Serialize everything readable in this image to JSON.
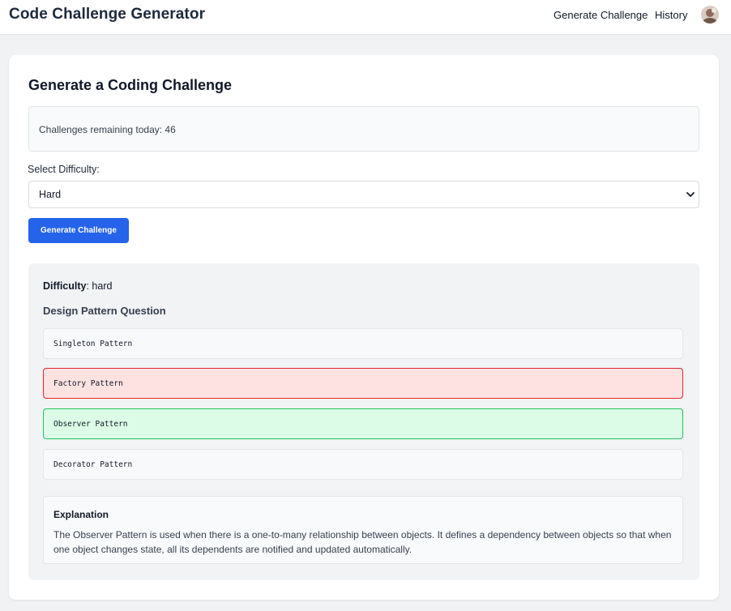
{
  "header": {
    "title": "Code Challenge Generator",
    "nav": {
      "generate": "Generate Challenge",
      "history": "History"
    }
  },
  "main": {
    "title": "Generate a Coding Challenge",
    "remaining": "Challenges remaining today: 46",
    "difficulty_label": "Select Difficulty:",
    "difficulty_selected": "Hard",
    "generate_button": "Generate Challenge"
  },
  "challenge": {
    "difficulty_key": "Difficulty",
    "difficulty_value": ": hard",
    "question": "Design Pattern Question",
    "options": [
      {
        "text": "Singleton Pattern",
        "state": "neutral"
      },
      {
        "text": "Factory Pattern",
        "state": "incorrect"
      },
      {
        "text": "Observer Pattern",
        "state": "correct"
      },
      {
        "text": "Decorator Pattern",
        "state": "neutral"
      }
    ],
    "explanation_title": "Explanation",
    "explanation": "The Observer Pattern is used when there is a one-to-many relationship between objects. It defines a dependency between objects so that when one object changes state, all its dependents are notified and updated automatically."
  },
  "colors": {
    "accent": "#2563eb",
    "incorrect_bg": "#fee2e2",
    "incorrect_border": "#dc2626",
    "correct_bg": "#dcfce7",
    "correct_border": "#22c55e"
  },
  "icons": {
    "avatar": "user-avatar",
    "select": "chevron-down-icon"
  }
}
